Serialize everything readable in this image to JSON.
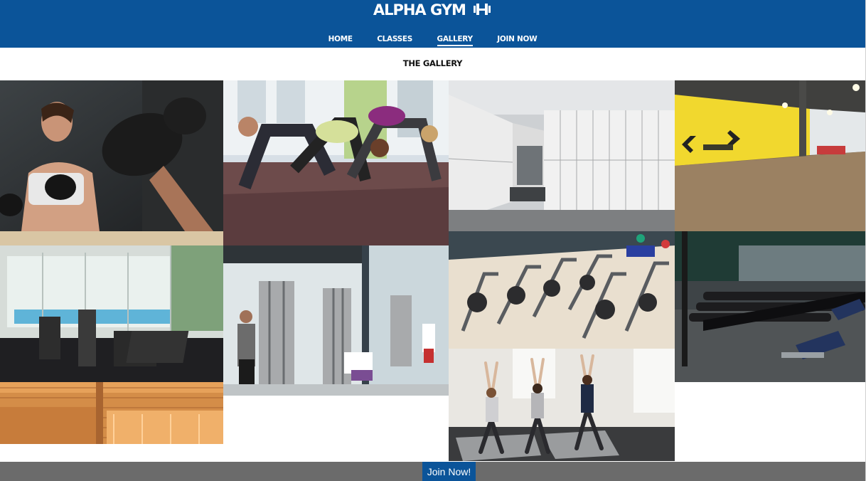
{
  "brand": {
    "name": "ALPHA GYM",
    "icon": "dumbbell-icon",
    "color": "#0b5499"
  },
  "nav": {
    "items": [
      {
        "label": "HOME",
        "active": false
      },
      {
        "label": "CLASSES",
        "active": false
      },
      {
        "label": "GALLERY",
        "active": true
      },
      {
        "label": "JOIN NOW",
        "active": false
      }
    ]
  },
  "gallery": {
    "title": "THE GALLERY",
    "photos": [
      {
        "subject": "boxing-training"
      },
      {
        "subject": "bear-crawl-class"
      },
      {
        "subject": "locker-room"
      },
      {
        "subject": "studio-room"
      },
      {
        "subject": "treadmill-room"
      },
      {
        "subject": "cable-machines"
      },
      {
        "subject": "spin-bikes"
      },
      {
        "subject": "dumbbell-rack"
      },
      {
        "subject": "sauna"
      },
      {
        "subject": "yoga-class"
      }
    ]
  },
  "footer": {
    "join_label": "Join Now!",
    "background": "#6b6b6b"
  }
}
